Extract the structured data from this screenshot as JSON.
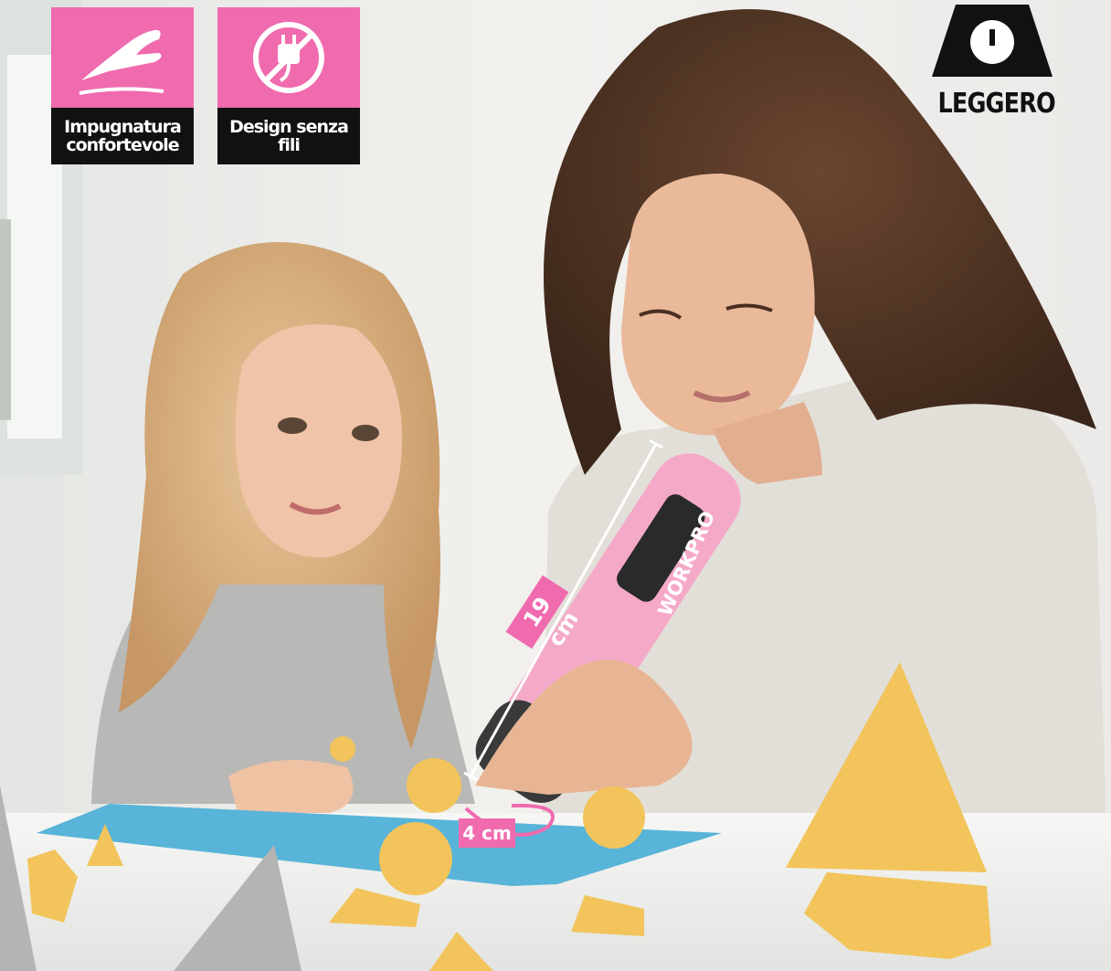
{
  "features": [
    {
      "icon": "hand-icon",
      "label": "Impugnatura confortevole"
    },
    {
      "icon": "no-plug-icon",
      "label": "Design senza fili"
    }
  ],
  "weight_badge": {
    "icon": "weight-icon",
    "label": "LEGGERO"
  },
  "dimensions": {
    "length": "19 cm",
    "width": "4 cm"
  },
  "product": {
    "brand": "WORKPRO"
  },
  "colors": {
    "accent": "#f06aae",
    "label_bg": "#111111"
  }
}
